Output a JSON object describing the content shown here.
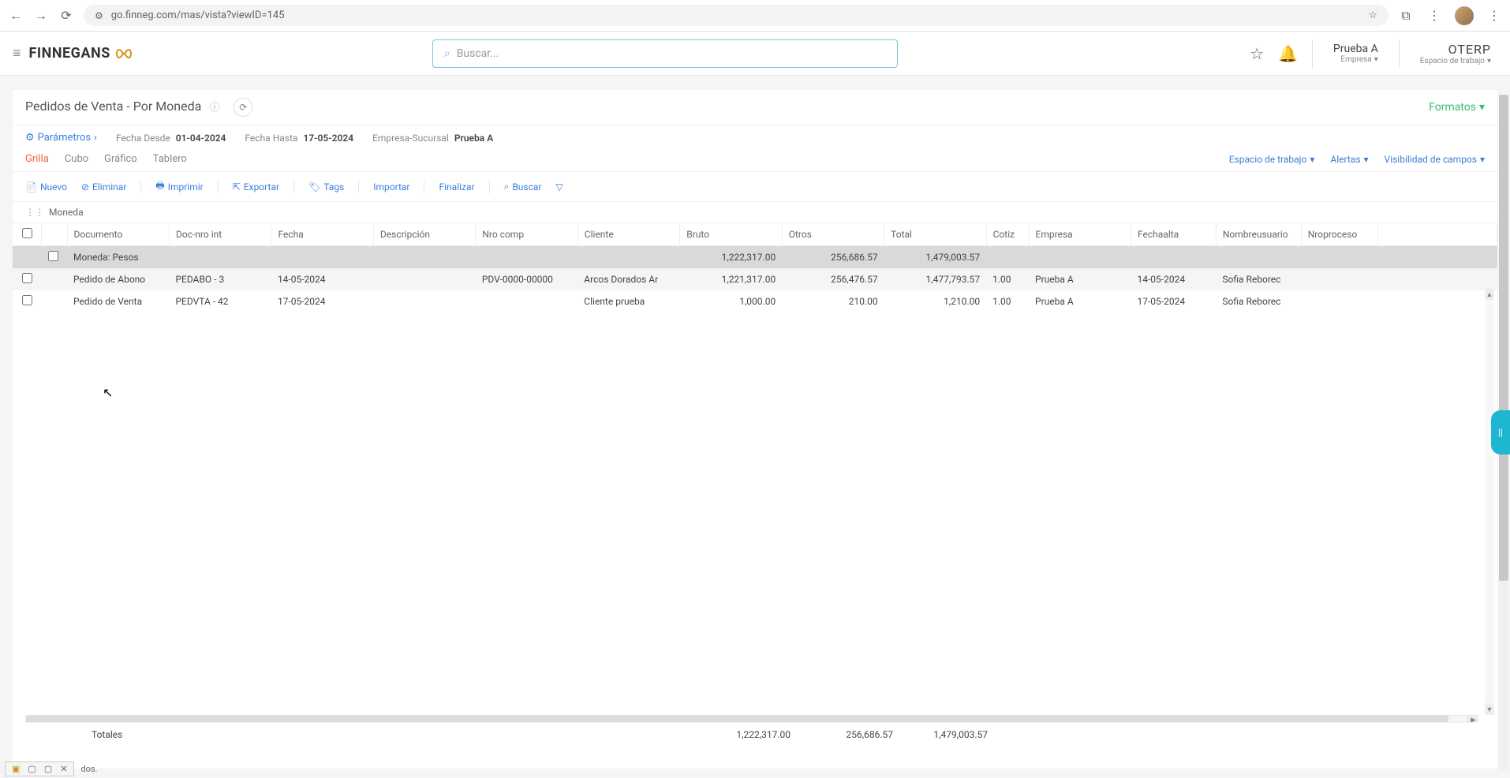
{
  "browser": {
    "url": "go.finneg.com/mas/vista?viewID=145"
  },
  "header": {
    "logo_text": "FINNEGANS",
    "search_placeholder": "Buscar...",
    "user_name": "Prueba A",
    "user_sublabel": "Empresa",
    "workspace_name": "OTERP",
    "workspace_sublabel": "Espacio de trabajo"
  },
  "page": {
    "title": "Pedidos de Venta - Por Moneda",
    "formats_label": "Formatos"
  },
  "params": {
    "button": "Parámetros",
    "items": [
      {
        "label": "Fecha Desde",
        "value": "01-04-2024"
      },
      {
        "label": "Fecha Hasta",
        "value": "17-05-2024"
      },
      {
        "label": "Empresa-Sucursal",
        "value": "Prueba A"
      }
    ]
  },
  "tabs": {
    "items": [
      "Grilla",
      "Cubo",
      "Gráfico",
      "Tablero"
    ],
    "active_index": 0,
    "right": [
      "Espacio de trabajo",
      "Alertas",
      "Visibilidad de campos"
    ]
  },
  "toolbar": {
    "nuevo": "Nuevo",
    "eliminar": "Eliminar",
    "imprimir": "Imprimir",
    "exportar": "Exportar",
    "tags": "Tags",
    "importar": "Importar",
    "finalizar": "Finalizar",
    "buscar": "Buscar"
  },
  "grouping": {
    "label": "Moneda"
  },
  "table": {
    "headers": {
      "documento": "Documento",
      "doc_nro_int": "Doc-nro int",
      "fecha": "Fecha",
      "descripcion": "Descripción",
      "nro_comp": "Nro comp",
      "cliente": "Cliente",
      "bruto": "Bruto",
      "otros": "Otros",
      "total": "Total",
      "cotiz": "Cotiz",
      "empresa": "Empresa",
      "fechaalta": "Fechaalta",
      "nombreusuario": "Nombreusuario",
      "nroproceso": "Nroproceso"
    },
    "group_header": {
      "label": "Moneda: Pesos",
      "bruto": "1,222,317.00",
      "otros": "256,686.57",
      "total": "1,479,003.57"
    },
    "rows": [
      {
        "documento": "Pedido de Abono",
        "doc_nro_int": "PEDABO - 3",
        "fecha": "14-05-2024",
        "descripcion": "",
        "nro_comp": "PDV-0000-00000",
        "cliente": "Arcos Dorados Ar",
        "bruto": "1,221,317.00",
        "otros": "256,476.57",
        "total": "1,477,793.57",
        "cotiz": "1.00",
        "empresa": "Prueba A",
        "fechaalta": "14-05-2024",
        "nombreusuario": "Sofia Reborec"
      },
      {
        "documento": "Pedido de Venta",
        "doc_nro_int": "PEDVTA - 42",
        "fecha": "17-05-2024",
        "descripcion": "",
        "nro_comp": "",
        "cliente": "Cliente prueba",
        "bruto": "1,000.00",
        "otros": "210.00",
        "total": "1,210.00",
        "cotiz": "1.00",
        "empresa": "Prueba A",
        "fechaalta": "17-05-2024",
        "nombreusuario": "Sofia Reborec"
      }
    ],
    "totals": {
      "label": "Totales",
      "bruto": "1,222,317.00",
      "otros": "256,686.57",
      "total": "1,479,003.57"
    }
  },
  "taskbar": {
    "truncated": "dos."
  }
}
